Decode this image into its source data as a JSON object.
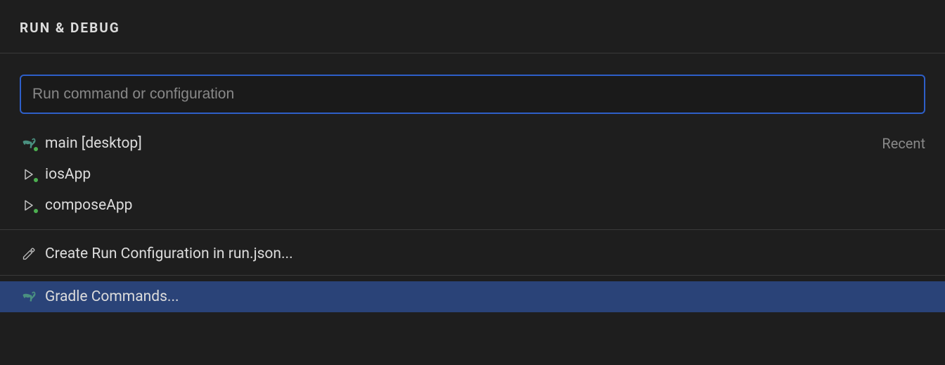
{
  "header": {
    "title": "RUN & DEBUG"
  },
  "search": {
    "placeholder": "Run command or configuration",
    "value": ""
  },
  "items": [
    {
      "label": "main [desktop]",
      "hint": "Recent"
    },
    {
      "label": "iosApp"
    },
    {
      "label": "composeApp"
    }
  ],
  "action": {
    "label": "Create Run Configuration in run.json..."
  },
  "command": {
    "label": "Gradle Commands..."
  }
}
